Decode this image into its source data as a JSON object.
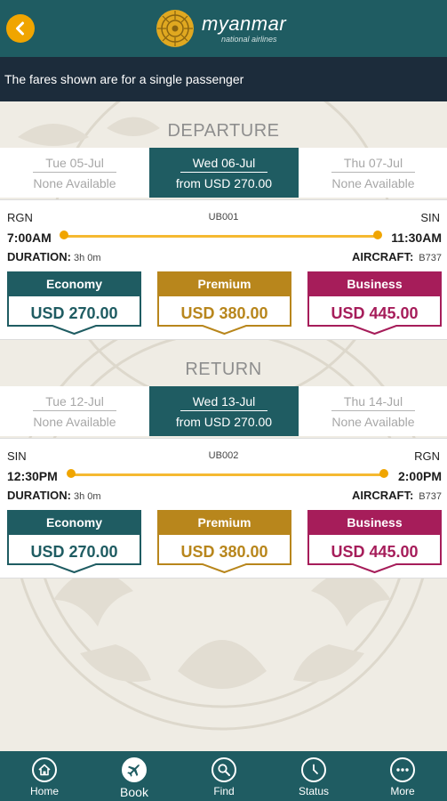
{
  "header": {
    "brand_name": "myanmar",
    "brand_sub": "national airlines"
  },
  "notice": "The fares shown are for a single passenger",
  "colors": {
    "header": "#1f5c62",
    "accent": "#f0a500",
    "economy": "#1f5c62",
    "premium": "#b8861c",
    "business": "#a61d5a"
  },
  "departure": {
    "title": "DEPARTURE",
    "dates": [
      {
        "date": "Tue 05-Jul",
        "fare": "None Available",
        "active": false
      },
      {
        "date": "Wed 06-Jul",
        "fare": "from USD 270.00",
        "active": true
      },
      {
        "date": "Thu 07-Jul",
        "fare": "None Available",
        "active": false
      }
    ],
    "flight": {
      "from": "RGN",
      "to": "SIN",
      "number": "UB001",
      "depart_time": "7:00AM",
      "arrive_time": "11:30AM",
      "duration_label": "DURATION:",
      "duration": "3h 0m",
      "aircraft_label": "AIRCRAFT:",
      "aircraft": "B737"
    },
    "fares": [
      {
        "cabin": "Economy",
        "price": "USD 270.00"
      },
      {
        "cabin": "Premium",
        "price": "USD 380.00"
      },
      {
        "cabin": "Business",
        "price": "USD 445.00"
      }
    ]
  },
  "return": {
    "title": "RETURN",
    "dates": [
      {
        "date": "Tue 12-Jul",
        "fare": "None Available",
        "active": false
      },
      {
        "date": "Wed 13-Jul",
        "fare": "from USD 270.00",
        "active": true
      },
      {
        "date": "Thu 14-Jul",
        "fare": "None Available",
        "active": false
      }
    ],
    "flight": {
      "from": "SIN",
      "to": "RGN",
      "number": "UB002",
      "depart_time": "12:30PM",
      "arrive_time": "2:00PM",
      "duration_label": "DURATION:",
      "duration": "3h 0m",
      "aircraft_label": "AIRCRAFT:",
      "aircraft": "B737"
    },
    "fares": [
      {
        "cabin": "Economy",
        "price": "USD 270.00"
      },
      {
        "cabin": "Premium",
        "price": "USD 380.00"
      },
      {
        "cabin": "Business",
        "price": "USD 445.00"
      }
    ]
  },
  "nav": {
    "items": [
      {
        "label": "Home",
        "icon": "home-icon"
      },
      {
        "label": "Book",
        "icon": "plane-icon",
        "active": true
      },
      {
        "label": "Find",
        "icon": "search-icon"
      },
      {
        "label": "Status",
        "icon": "clock-icon"
      },
      {
        "label": "More",
        "icon": "more-icon"
      }
    ]
  }
}
